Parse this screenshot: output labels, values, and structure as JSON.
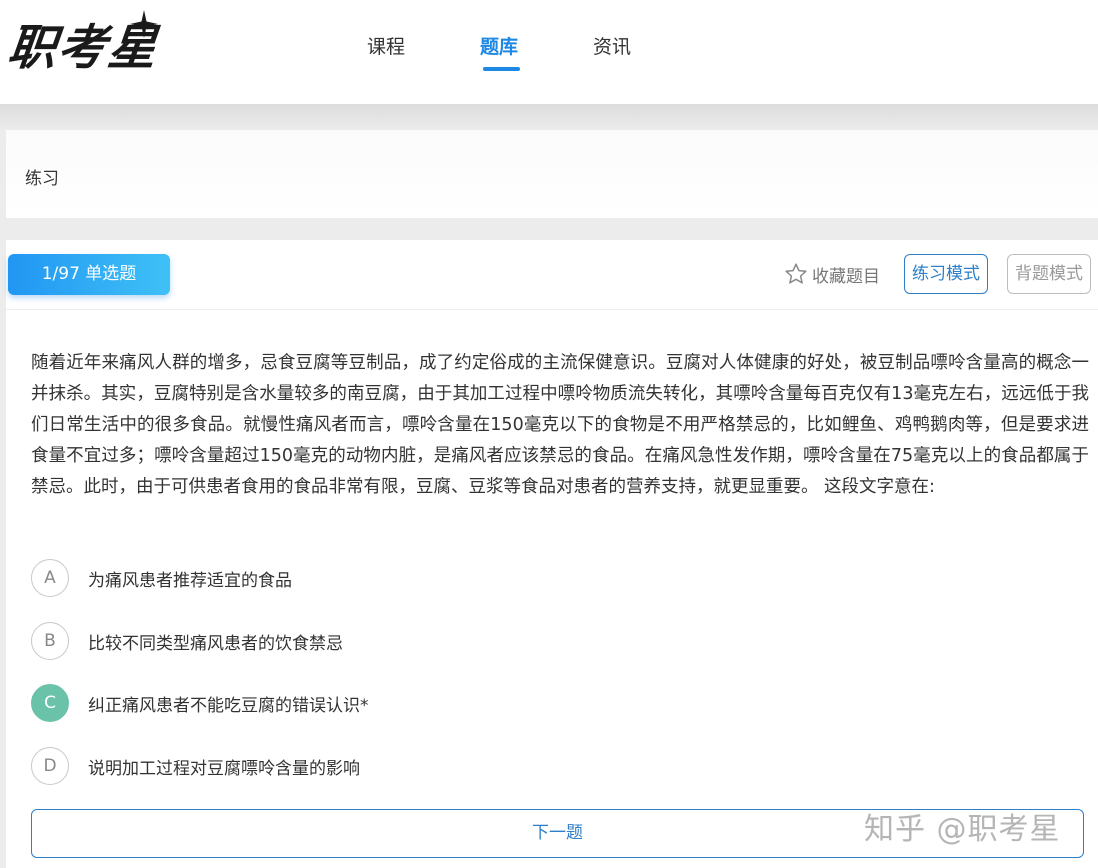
{
  "brand": {
    "logo_text": "职考星"
  },
  "nav": {
    "items": [
      {
        "label": "课程",
        "active": false
      },
      {
        "label": "题库",
        "active": true
      },
      {
        "label": "资讯",
        "active": false
      }
    ]
  },
  "section": {
    "title": "练习"
  },
  "question": {
    "tag": "1/97 单选题",
    "favorite_label": "收藏题目",
    "modes": {
      "practice": "练习模式",
      "recite": "背题模式"
    },
    "stem": "随着近年来痛风人群的增多，忌食豆腐等豆制品，成了约定俗成的主流保健意识。豆腐对人体健康的好处，被豆制品嘌呤含量高的概念一并抹杀。其实，豆腐特别是含水量较多的南豆腐，由于其加工过程中嘌呤物质流失转化，其嘌呤含量每百克仅有13毫克左右，远远低于我们日常生活中的很多食品。就慢性痛风者而言，嘌呤含量在150毫克以下的食物是不用严格禁忌的，比如鲤鱼、鸡鸭鹅肉等，但是要求进食量不宜过多；嘌呤含量超过150毫克的动物内脏，是痛风者应该禁忌的食品。在痛风急性发作期，嘌呤含量在75毫克以上的食品都属于禁忌。此时，由于可供患者食用的食品非常有限，豆腐、豆浆等食品对患者的营养支持，就更显重要。 这段文字意在:",
    "options": [
      {
        "letter": "A",
        "text": "为痛风患者推荐适宜的食品",
        "selected": false
      },
      {
        "letter": "B",
        "text": "比较不同类型痛风患者的饮食禁忌",
        "selected": false
      },
      {
        "letter": "C",
        "text": "纠正痛风患者不能吃豆腐的错误认识*",
        "selected": true
      },
      {
        "letter": "D",
        "text": "说明加工过程对豆腐嘌呤含量的影响",
        "selected": false
      }
    ],
    "next_label": "下一题"
  },
  "watermark": "知乎 @职考星",
  "colors": {
    "accent": "#1e88e5",
    "selected_option": "#6ac3a8",
    "tag_gradient_start": "#2196f3",
    "tag_gradient_end": "#3fc1f6"
  }
}
